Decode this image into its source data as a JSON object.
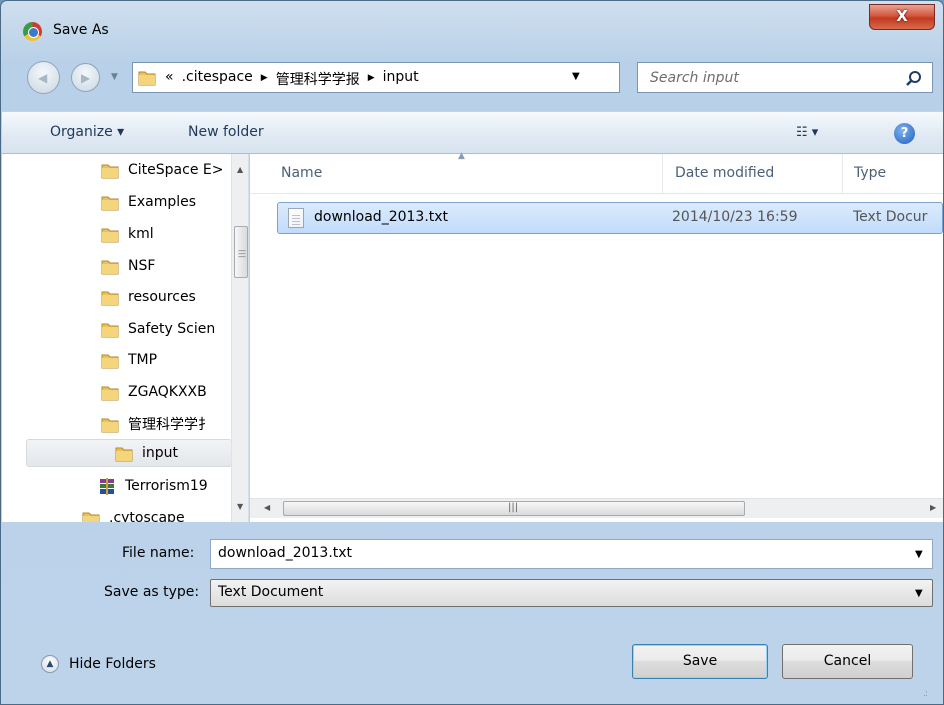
{
  "window": {
    "title": "Save As",
    "close_label": "X"
  },
  "address": {
    "overflow": "«",
    "crumbs": [
      ".citespace",
      "管理科学学报",
      "input"
    ],
    "search_placeholder": "Search input"
  },
  "toolbar": {
    "organize": "Organize ▾",
    "new_folder": "New folder",
    "view_icon": "view-menu-icon",
    "help": "?"
  },
  "nav": {
    "items": [
      {
        "label": "CiteSpace E>",
        "selected": false
      },
      {
        "label": "Examples",
        "selected": false
      },
      {
        "label": "kml",
        "selected": false
      },
      {
        "label": "NSF",
        "selected": false
      },
      {
        "label": "resources",
        "selected": false
      },
      {
        "label": "Safety Scien",
        "selected": false
      },
      {
        "label": "TMP",
        "selected": false
      },
      {
        "label": "ZGAQKXXB",
        "selected": false
      },
      {
        "label": "管理科学学扌",
        "selected": false
      },
      {
        "label": "input",
        "selected": true
      },
      {
        "label": "Terrorism19",
        "selected": false
      },
      {
        "label": ".cytoscape",
        "selected": false
      }
    ]
  },
  "columns": {
    "name": "Name",
    "date": "Date modified",
    "type": "Type"
  },
  "files": [
    {
      "name": "download_2013.txt",
      "date": "2014/10/23 16:59",
      "type": "Text Docur"
    }
  ],
  "form": {
    "file_name_label": "File name:",
    "file_name_value": "download_2013.txt",
    "save_type_label": "Save as type:",
    "save_type_value": "Text Document"
  },
  "footer": {
    "hide_folders": "Hide Folders",
    "save": "Save",
    "cancel": "Cancel"
  },
  "colors": {
    "folder": "#e8c25a",
    "selection": "#c1dbfc",
    "close": "#c9452a"
  }
}
